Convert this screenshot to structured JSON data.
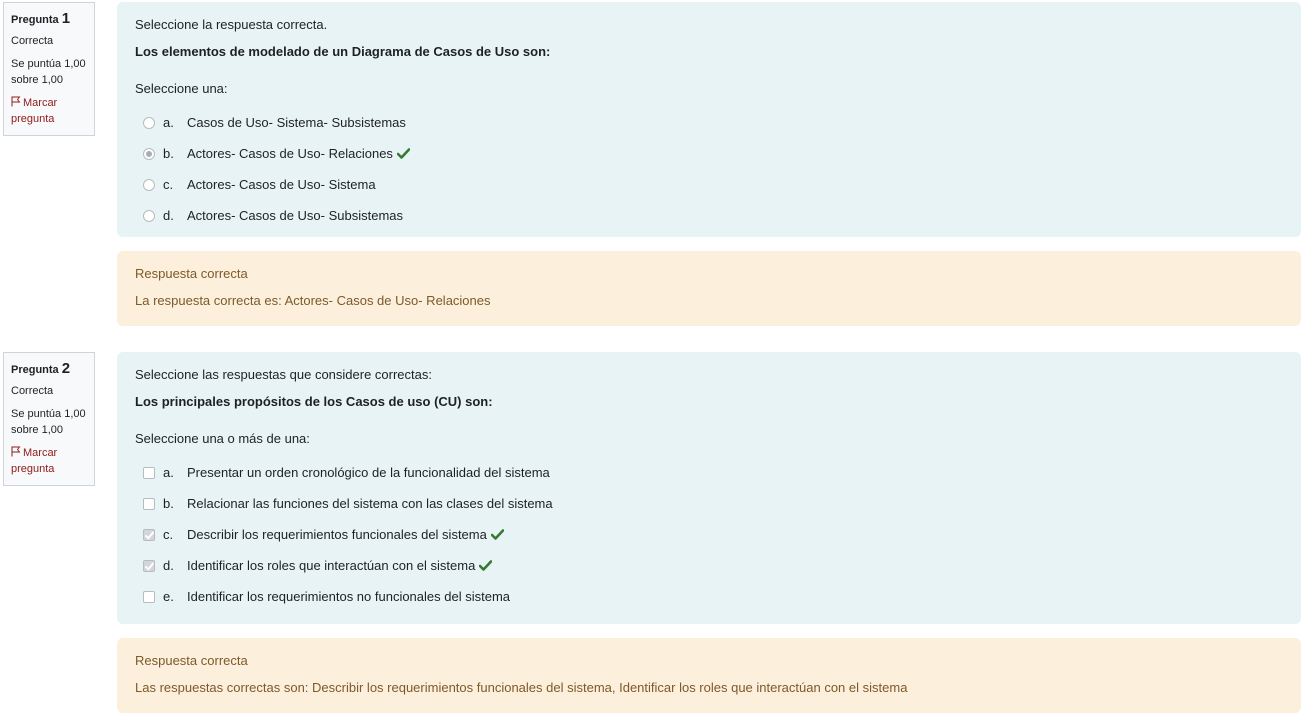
{
  "questions": [
    {
      "qno_label": "Pregunta",
      "qno": "1",
      "state": "Correcta",
      "grade": "Se puntúa 1,00 sobre 1,00",
      "flag_label": "Marcar pregunta",
      "intro": "Seleccione la respuesta correcta.",
      "stem": "Los elementos de modelado de un Diagrama de Casos de Uso son:",
      "prompt": "Seleccione una:",
      "answers": [
        {
          "letter": "a.",
          "text": "Casos de Uso- Sistema- Subsistemas"
        },
        {
          "letter": "b.",
          "text": "Actores- Casos de Uso- Relaciones"
        },
        {
          "letter": "c.",
          "text": "Actores- Casos de Uso- Sistema"
        },
        {
          "letter": "d.",
          "text": "Actores- Casos de Uso- Subsistemas"
        }
      ],
      "feedback": "Respuesta correcta",
      "right_answer": "La respuesta correcta es: Actores- Casos de Uso- Relaciones"
    },
    {
      "qno_label": "Pregunta",
      "qno": "2",
      "state": "Correcta",
      "grade": "Se puntúa 1,00 sobre 1,00",
      "flag_label": "Marcar pregunta",
      "intro": "Seleccione las respuestas que considere correctas:",
      "stem": "Los principales propósitos de los Casos de uso (CU) son:",
      "prompt": "Seleccione una o más de una:",
      "answers": [
        {
          "letter": "a.",
          "text": "Presentar un orden cronológico de la funcionalidad del sistema"
        },
        {
          "letter": "b.",
          "text": "Relacionar las funciones del sistema con las clases del sistema"
        },
        {
          "letter": "c.",
          "text": "Describir los requerimientos funcionales del sistema"
        },
        {
          "letter": "d.",
          "text": "Identificar los roles que interactúan con el sistema"
        },
        {
          "letter": "e.",
          "text": "Identificar los requerimientos no funcionales del sistema"
        }
      ],
      "feedback": "Respuesta correcta",
      "right_answer": "Las respuestas correctas son: Describir los requerimientos funcionales del sistema, Identificar los roles que interactúan con el sistema"
    }
  ],
  "colors": {
    "formulation_bg": "#e7f3f5",
    "outcome_bg": "#fcefdc",
    "outcome_text": "#7d5a29",
    "correct_tick": "#357a32",
    "flag_text": "#8f1b1b"
  }
}
